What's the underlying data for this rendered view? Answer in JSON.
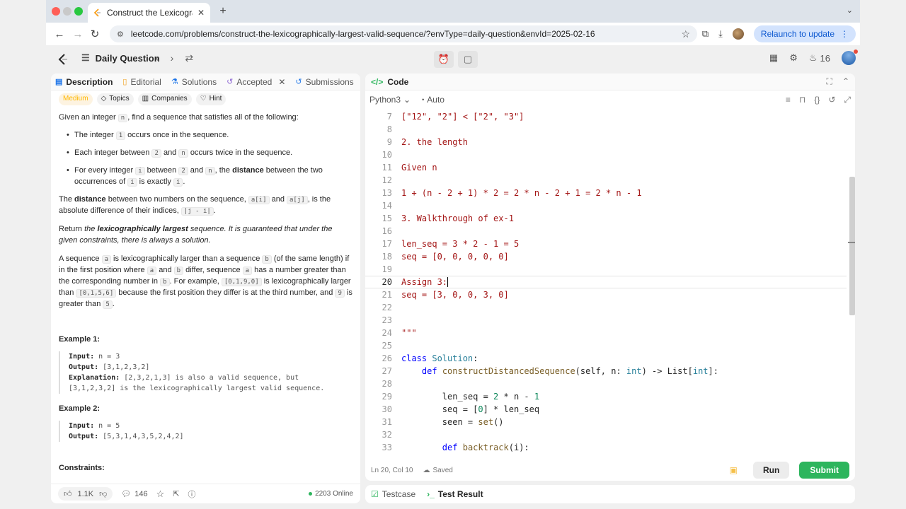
{
  "browser": {
    "tab_title": "Construct the Lexicographica",
    "url": "leetcode.com/problems/construct-the-lexicographically-largest-valid-sequence/?envType=daily-question&envId=2025-02-16",
    "relaunch_label": "Relaunch to update"
  },
  "lc_nav": {
    "daily_question": "Daily Question",
    "streak_count": "16"
  },
  "left_tabs": {
    "description": "Description",
    "editorial": "Editorial",
    "solutions": "Solutions",
    "accepted": "Accepted",
    "submissions": "Submissions"
  },
  "problem": {
    "difficulty": "Medium",
    "tag_topics": "Topics",
    "tag_companies": "Companies",
    "tag_hint": "Hint",
    "intro_a": "Given an integer ",
    "intro_n": "n",
    "intro_b": ", find a sequence that satisfies all of the following:",
    "b1_a": "The integer ",
    "b1_code": "1",
    "b1_b": " occurs once in the sequence.",
    "b2_a": "Each integer between ",
    "b2_code1": "2",
    "b2_mid": " and ",
    "b2_code2": "n",
    "b2_b": " occurs twice in the sequence.",
    "b3_a": "For every integer ",
    "b3_code1": "i",
    "b3_b": " between ",
    "b3_code2": "2",
    "b3_c": " and ",
    "b3_code3": "n",
    "b3_d": ", the ",
    "b3_bold": "distance",
    "b3_e": " between the two occurrences of ",
    "b3_code4": "i",
    "b3_f": " is exactly ",
    "b3_code5": "i",
    "b3_g": ".",
    "p2_a": "The ",
    "p2_bold": "distance",
    "p2_b": " between two numbers on the sequence, ",
    "p2_code1": "a[i]",
    "p2_c": " and ",
    "p2_code2": "a[j]",
    "p2_d": ", is the absolute difference of their indices, ",
    "p2_code3": "|j - i|",
    "p2_e": ".",
    "p3_a": "Return ",
    "p3_i1": "the ",
    "p3_bi": "lexicographically largest",
    "p3_i2": " sequence. It is guaranteed that under the given constraints, there is always a solution.",
    "p4_a": "A sequence ",
    "p4_c1": "a",
    "p4_b": " is lexicographically larger than a sequence ",
    "p4_c2": "b",
    "p4_c": " (of the same length) if in the first position where ",
    "p4_c3": "a",
    "p4_d": " and ",
    "p4_c4": "b",
    "p4_e": " differ, sequence ",
    "p4_c5": "a",
    "p4_f": " has a number greater than the corresponding number in ",
    "p4_c6": "b",
    "p4_g": ". For example, ",
    "p4_c7": "[0,1,9,0]",
    "p4_h": " is lexicographically larger than ",
    "p4_c8": "[0,1,5,6]",
    "p4_i": " because the first position they differ is at the third number, and ",
    "p4_c9": "9",
    "p4_j": " is greater than ",
    "p4_c10": "5",
    "p4_k": ".",
    "ex1_title": "Example 1:",
    "ex1_input_label": "Input:",
    "ex1_input": " n = 3",
    "ex1_output_label": "Output:",
    "ex1_output": " [3,1,2,3,2]",
    "ex1_expl_label": "Explanation:",
    "ex1_expl": " [2,3,2,1,3] is also a valid sequence, but",
    "ex1_expl2": "[3,1,2,3,2] is the lexicographically largest valid sequence.",
    "ex2_title": "Example 2:",
    "ex2_input_label": "Input:",
    "ex2_input": " n = 5",
    "ex2_output_label": "Output:",
    "ex2_output": " [5,3,1,4,3,5,2,4,2]",
    "constraints_title": "Constraints:"
  },
  "left_footer": {
    "likes": "1.1K",
    "comments": "146",
    "online": "2203 Online"
  },
  "code_panel": {
    "title": "Code",
    "language": "Python3",
    "mode": "Auto",
    "status_pos": "Ln 20, Col 10",
    "status_saved": "Saved",
    "run_label": "Run",
    "submit_label": "Submit"
  },
  "code_lines": [
    {
      "n": "7",
      "t": "[\"12\", \"2\"] < [\"2\", \"3\"]"
    },
    {
      "n": "8",
      "t": ""
    },
    {
      "n": "9",
      "t": "2. the length"
    },
    {
      "n": "10",
      "t": ""
    },
    {
      "n": "11",
      "t": "Given n"
    },
    {
      "n": "12",
      "t": ""
    },
    {
      "n": "13",
      "t": "1 + (n - 2 + 1) * 2 = 2 * n - 2 + 1 = 2 * n - 1"
    },
    {
      "n": "14",
      "t": ""
    },
    {
      "n": "15",
      "t": "3. Walkthrough of ex-1"
    },
    {
      "n": "16",
      "t": ""
    },
    {
      "n": "17",
      "t": "len_seq = 3 * 2 - 1 = 5"
    },
    {
      "n": "18",
      "t": "seq = [0, 0, 0, 0, 0]"
    },
    {
      "n": "19",
      "t": ""
    },
    {
      "n": "20",
      "t": "Assign 3:"
    },
    {
      "n": "21",
      "t": "seq = [3, 0, 0, 3, 0]"
    },
    {
      "n": "22",
      "t": ""
    },
    {
      "n": "23",
      "t": ""
    },
    {
      "n": "24",
      "t": "\"\"\""
    },
    {
      "n": "25",
      "t": ""
    },
    {
      "n": "26",
      "t": "class Solution:"
    },
    {
      "n": "27",
      "t": "    def constructDistancedSequence(self, n: int) -> List[int]:"
    },
    {
      "n": "28",
      "t": ""
    },
    {
      "n": "29",
      "t": "        len_seq = 2 * n - 1"
    },
    {
      "n": "30",
      "t": "        seq = [0] * len_seq"
    },
    {
      "n": "31",
      "t": "        seen = set()"
    },
    {
      "n": "32",
      "t": ""
    },
    {
      "n": "33",
      "t": "        def backtrack(i):"
    }
  ],
  "bottom_tabs": {
    "testcase": "Testcase",
    "test_result": "Test Result"
  },
  "colors": {
    "submit_green": "#2db55d",
    "medium_orange": "#ffb800",
    "string_red": "#a31515",
    "keyword_blue": "#0000ff"
  }
}
